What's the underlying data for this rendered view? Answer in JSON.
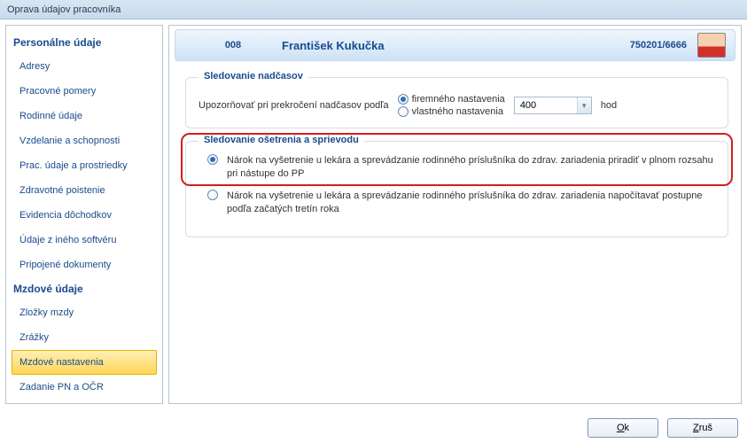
{
  "window": {
    "title": "Oprava údajov pracovníka"
  },
  "sidebar": {
    "sections": [
      {
        "title": "Personálne údaje",
        "items": [
          {
            "label": "Adresy"
          },
          {
            "label": "Pracovné pomery"
          },
          {
            "label": "Rodinné údaje"
          },
          {
            "label": "Vzdelanie a schopnosti"
          },
          {
            "label": "Prac. údaje a prostriedky"
          },
          {
            "label": "Zdravotné poistenie"
          },
          {
            "label": "Evidencia dôchodkov"
          },
          {
            "label": "Údaje z iného softvéru"
          },
          {
            "label": "Pripojené dokumenty"
          }
        ]
      },
      {
        "title": "Mzdové údaje",
        "items": [
          {
            "label": "Zložky mzdy"
          },
          {
            "label": "Zrážky"
          },
          {
            "label": "Mzdové nastavenia",
            "selected": true
          },
          {
            "label": "Zadanie PN a OČR"
          }
        ]
      }
    ]
  },
  "employee": {
    "code": "008",
    "name": "František Kukučka",
    "id": "750201/6666"
  },
  "overtime": {
    "title": "Sledovanie nadčasov",
    "label": "Upozorňovať pri prekročení nadčasov podľa",
    "options": {
      "company": "firemného nastavenia",
      "own": "vlastného nastavenia"
    },
    "selected": "company",
    "hours_value": "400",
    "hours_unit": "hod"
  },
  "care": {
    "title": "Sledovanie ošetrenia a sprievodu",
    "options": [
      {
        "label": "Nárok na vyšetrenie u lekára a sprevádzanie rodinného príslušníka do zdrav. zariadenia priradiť v plnom rozsahu pri nástupe do PP"
      },
      {
        "label": "Nárok na vyšetrenie u lekára a sprevádzanie rodinného príslušníka do zdrav. zariadenia napočítavať postupne podľa začatých tretín roka"
      }
    ],
    "selected_index": 0
  },
  "buttons": {
    "ok_mn": "O",
    "ok_rest": "k",
    "cancel_mn": "Z",
    "cancel_rest": "ruš"
  }
}
